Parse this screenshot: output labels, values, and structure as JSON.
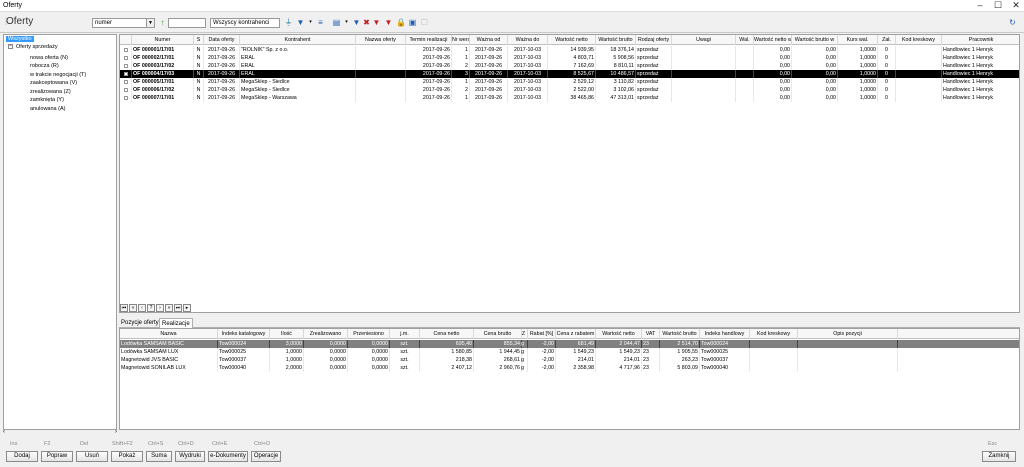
{
  "window": {
    "title": "Oferty"
  },
  "toolbar": {
    "title": "Oferty",
    "search_field": "numer",
    "search_value": "",
    "contractor_filter": "Wszyscy kontrahenci"
  },
  "tree": {
    "root": "Wszystko",
    "group": "Oferty sprzedaży",
    "items": [
      "nowa oferta (N)",
      "robocza (R)",
      "w trakcie negocjacji (T)",
      "zaakceptowana (V)",
      "zrealizowana (Z)",
      "zamknięta (Y)",
      "anulowana (A)"
    ]
  },
  "offers": {
    "columns": [
      "Numer",
      "S",
      "Data oferty",
      "Kontrahent",
      "Nazwa oferty",
      "Termin realizacji",
      "Nr wersji",
      "Ważna od",
      "Ważna do",
      "Wartość netto",
      "Wartość brutto",
      "Rodzaj oferty",
      "Uwagi",
      "Wal.",
      "Wartość netto w",
      "Wartość brutto w",
      "Kurs wal.",
      "Zał.",
      "Kod kreskowy",
      "Pracownik"
    ],
    "rows": [
      {
        "num": "OF 000001/17/01",
        "s": "N",
        "date": "2017-09-26",
        "contractor": "\"ROLNIK\" Sp. z o.o.",
        "term": "2017-09-26",
        "ver": "1",
        "from": "2017-09-26",
        "to": "2017-10-03",
        "net": "14 939,95",
        "gross": "18 376,14",
        "kind": "sprzedaż",
        "netw": "0,00",
        "grossw": "0,00",
        "rate": "1,0000",
        "att": "0",
        "emp": "Handlowiec 1 Henryk"
      },
      {
        "num": "OF 000002/17/01",
        "s": "N",
        "date": "2017-09-26",
        "contractor": "ERAL",
        "term": "2017-09-26",
        "ver": "1",
        "from": "2017-09-26",
        "to": "2017-10-03",
        "net": "4 803,71",
        "gross": "5 908,56",
        "kind": "sprzedaż",
        "netw": "0,00",
        "grossw": "0,00",
        "rate": "1,0000",
        "att": "0",
        "emp": "Handlowiec 1 Henryk"
      },
      {
        "num": "OF 000003/17/02",
        "s": "N",
        "date": "2017-09-26",
        "contractor": "ERAL",
        "term": "2017-09-26",
        "ver": "2",
        "from": "2017-09-26",
        "to": "2017-10-03",
        "net": "7 162,69",
        "gross": "8 810,11",
        "kind": "sprzedaż",
        "netw": "0,00",
        "grossw": "0,00",
        "rate": "1,0000",
        "att": "0",
        "emp": "Handlowiec 1 Henryk"
      },
      {
        "num": "OF 000004/17/03",
        "s": "N",
        "date": "2017-09-26",
        "contractor": "ERAL",
        "term": "2017-09-26",
        "ver": "3",
        "from": "2017-09-26",
        "to": "2017-10-03",
        "net": "8 525,67",
        "gross": "10 486,57",
        "kind": "sprzedaż",
        "netw": "0,00",
        "grossw": "0,00",
        "rate": "1,0000",
        "att": "0",
        "emp": "Handlowiec 1 Henryk"
      },
      {
        "num": "OF 000005/17/01",
        "s": "N",
        "date": "2017-09-26",
        "contractor": "MegaSklep - Siedlce",
        "term": "2017-09-26",
        "ver": "1",
        "from": "2017-09-26",
        "to": "2017-10-03",
        "net": "2 529,12",
        "gross": "3 110,82",
        "kind": "sprzedaż",
        "netw": "0,00",
        "grossw": "0,00",
        "rate": "1,0000",
        "att": "0",
        "emp": "Handlowiec 1 Henryk"
      },
      {
        "num": "OF 000006/17/02",
        "s": "N",
        "date": "2017-09-26",
        "contractor": "MegaSklep - Siedlce",
        "term": "2017-09-26",
        "ver": "2",
        "from": "2017-09-26",
        "to": "2017-10-03",
        "net": "2 522,00",
        "gross": "3 102,06",
        "kind": "sprzedaż",
        "netw": "0,00",
        "grossw": "0,00",
        "rate": "1,0000",
        "att": "0",
        "emp": "Handlowiec 1 Henryk"
      },
      {
        "num": "OF 000007/17/01",
        "s": "N",
        "date": "2017-09-26",
        "contractor": "MegaSklep - Warszawa",
        "term": "2017-09-26",
        "ver": "1",
        "from": "2017-09-26",
        "to": "2017-10-03",
        "net": "38 465,86",
        "gross": "47 313,01",
        "kind": "sprzedaż",
        "netw": "0,00",
        "grossw": "0,00",
        "rate": "1,0000",
        "att": "0",
        "emp": "Handlowiec 1 Henryk"
      }
    ]
  },
  "tabs": [
    "Pozycje oferty",
    "Realizacje"
  ],
  "positions": {
    "columns": [
      "Nazwa",
      "Indeks katalogowy",
      "Ilość",
      "Zrealizowano",
      "Przeniesiono",
      "j.m.",
      "Cena netto",
      "Cena brutto",
      "Z",
      "Rabat [%]",
      "Cena z rabatem",
      "Wartość netto",
      "VAT",
      "Wartość brutto",
      "Indeks handlowy",
      "Kod kreskowy",
      "Opis pozycji"
    ],
    "rows": [
      {
        "name": "Lodówka SAMSAM BASIC",
        "idx": "Tow000024",
        "qty": "3,0000",
        "done": "0,0000",
        "moved": "0,0000",
        "jm": "szt.",
        "net": "695,40",
        "gross": "855,34",
        "z": "g",
        "disc": "-2,00",
        "pdisc": "681,49",
        "vnet": "2 044,47",
        "vat": "23",
        "vgross": "2 514,70",
        "hidx": "Tow000024"
      },
      {
        "name": "Lodówka SAMSAM LUX",
        "idx": "Tow000025",
        "qty": "1,0000",
        "done": "0,0000",
        "moved": "0,0000",
        "jm": "szt.",
        "net": "1 580,85",
        "gross": "1 944,45",
        "z": "g",
        "disc": "-2,00",
        "pdisc": "1 549,23",
        "vnet": "1 549,23",
        "vat": "23",
        "vgross": "1 905,55",
        "hidx": "Tow000025"
      },
      {
        "name": "Magnetowid JVS BASIC",
        "idx": "Tow000037",
        "qty": "1,0000",
        "done": "0,0000",
        "moved": "0,0000",
        "jm": "szt.",
        "net": "218,38",
        "gross": "268,61",
        "z": "g",
        "disc": "-2,00",
        "pdisc": "214,01",
        "vnet": "214,01",
        "vat": "23",
        "vgross": "263,23",
        "hidx": "Tow000037"
      },
      {
        "name": "Magnetowid SONILAB LUX",
        "idx": "Tow000040",
        "qty": "2,0000",
        "done": "0,0000",
        "moved": "0,0000",
        "jm": "szt.",
        "net": "2 407,12",
        "gross": "2 960,76",
        "z": "g",
        "disc": "-2,00",
        "pdisc": "2 358,98",
        "vnet": "4 717,96",
        "vat": "23",
        "vgross": "5 803,09",
        "hidx": "Tow000040"
      }
    ]
  },
  "buttons": [
    {
      "key": "Ins",
      "label": "Dodaj"
    },
    {
      "key": "F2",
      "label": "Popraw"
    },
    {
      "key": "Del",
      "label": "Usuń"
    },
    {
      "key": "Shift+F2",
      "label": "Pokaż"
    },
    {
      "key": "Ctrl+S",
      "label": "Suma"
    },
    {
      "key": "Ctrl+D",
      "label": "Wydruki"
    },
    {
      "key": "Ctrl+E",
      "label": "e-Dokumenty"
    },
    {
      "key": "Ctrl+O",
      "label": "Operacje"
    }
  ],
  "close": {
    "key": "Esc",
    "label": "Zamknij"
  }
}
